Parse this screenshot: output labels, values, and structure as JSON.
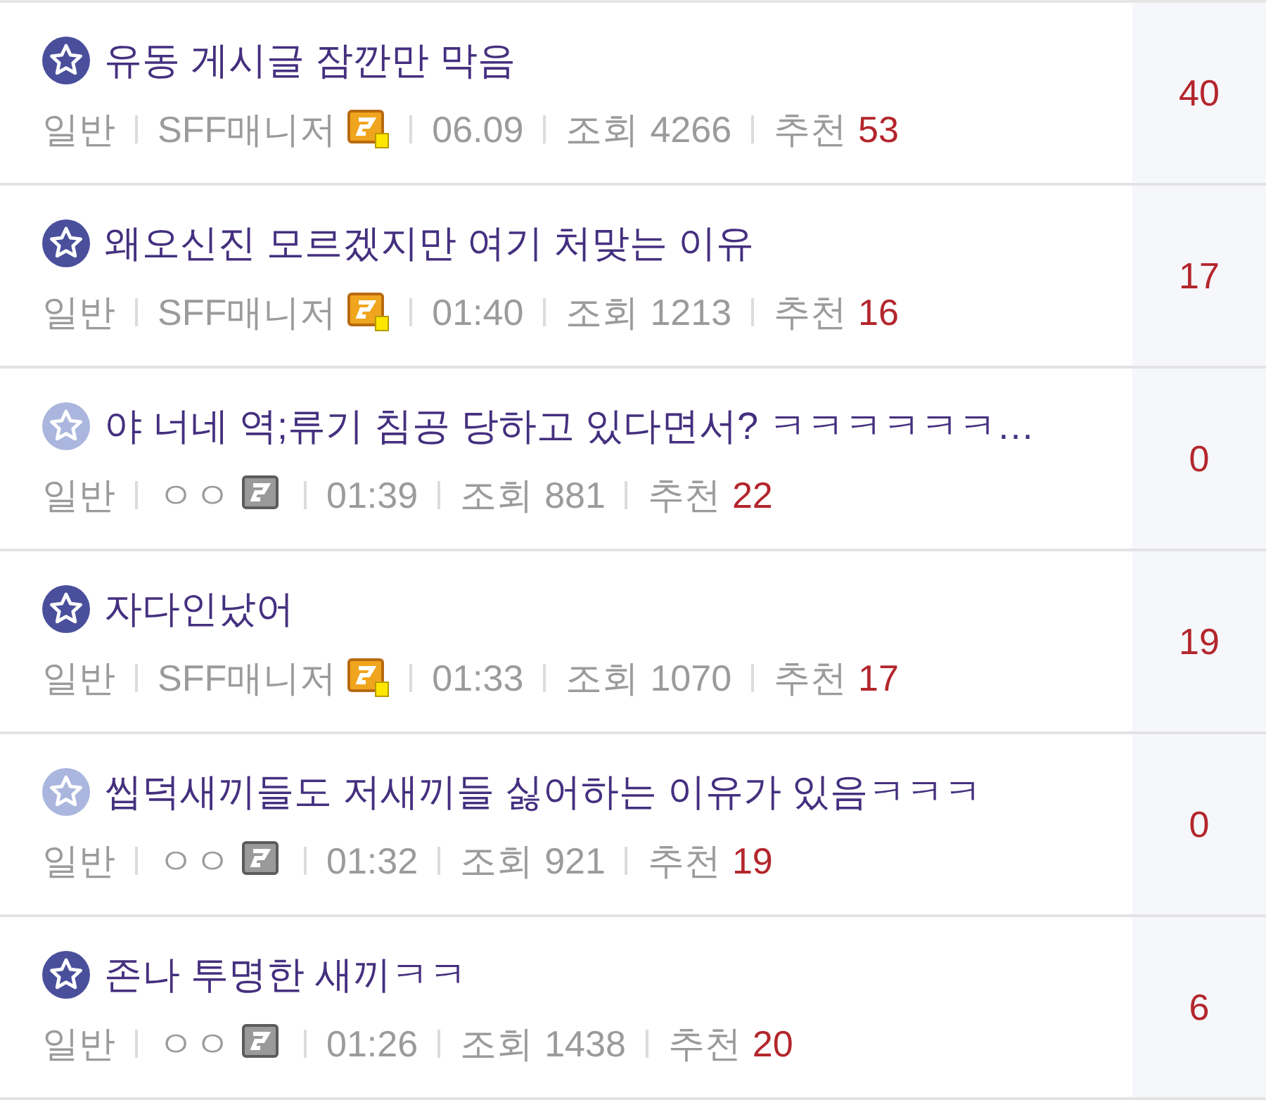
{
  "posts": [
    {
      "title": "유동 게시글 잠깐만 막음",
      "starred": true,
      "category": "일반",
      "author": "SFF매니저",
      "badge": {
        "kind": "manager"
      },
      "time": "06.09",
      "views_label": "조회",
      "views": "4266",
      "recommend_label": "추천",
      "recommend": "53",
      "comments": "40"
    },
    {
      "title": "왜오신진 모르겠지만 여기 처맞는 이유",
      "starred": true,
      "category": "일반",
      "author": "SFF매니저",
      "badge": {
        "kind": "manager"
      },
      "time": "01:40",
      "views_label": "조회",
      "views": "1213",
      "recommend_label": "추천",
      "recommend": "16",
      "comments": "17"
    },
    {
      "title": "야 너네 역;류기 침공 당하고 있다면서? ㅋㅋㅋㅋㅋㅋ…",
      "starred": false,
      "category": "일반",
      "author": "ㅇㅇ",
      "badge": {
        "kind": "fixed"
      },
      "time": "01:39",
      "views_label": "조회",
      "views": "881",
      "recommend_label": "추천",
      "recommend": "22",
      "comments": "0"
    },
    {
      "title": "자다인났어",
      "starred": true,
      "category": "일반",
      "author": "SFF매니저",
      "badge": {
        "kind": "manager"
      },
      "time": "01:33",
      "views_label": "조회",
      "views": "1070",
      "recommend_label": "추천",
      "recommend": "17",
      "comments": "19"
    },
    {
      "title": "씹덕새끼들도 저새끼들 싫어하는 이유가 있음ㅋㅋㅋ",
      "starred": false,
      "category": "일반",
      "author": "ㅇㅇ",
      "badge": {
        "kind": "fixed"
      },
      "time": "01:32",
      "views_label": "조회",
      "views": "921",
      "recommend_label": "추천",
      "recommend": "19",
      "comments": "0"
    },
    {
      "title": "존나 투명한 새끼ㅋㅋ",
      "starred": true,
      "category": "일반",
      "author": "ㅇㅇ",
      "badge": {
        "kind": "fixed"
      },
      "time": "01:26",
      "views_label": "조회",
      "views": "1438",
      "recommend_label": "추천",
      "recommend": "20",
      "comments": "6"
    }
  ]
}
